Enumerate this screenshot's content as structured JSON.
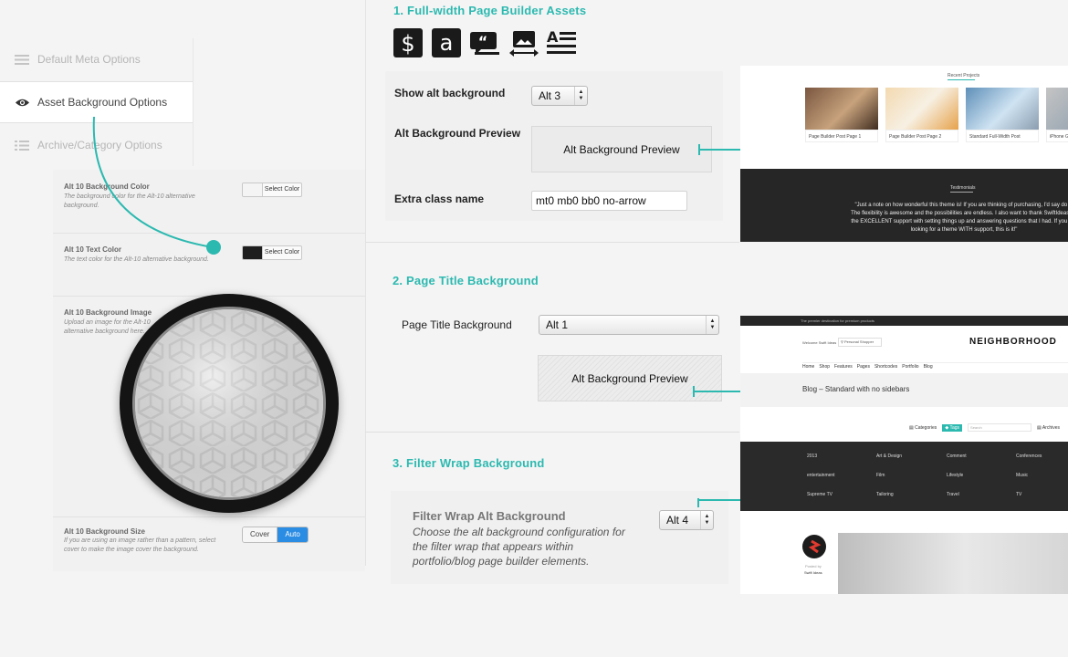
{
  "meta_tabs": [
    {
      "label": "Default Meta Options",
      "icon": "list-icon"
    },
    {
      "label": "Asset Background Options",
      "icon": "eye-icon"
    },
    {
      "label": "Archive/Category Options",
      "icon": "list-icon"
    }
  ],
  "options": {
    "bg_color": {
      "title": "Alt 10 Background Color",
      "desc": "The background color for the Alt-10 alternative background.",
      "button": "Select Color",
      "swatch": "#f4f4f4"
    },
    "text_color": {
      "title": "Alt 10 Text Color",
      "desc": "The text color for the Alt-10 alternative background.",
      "button": "Select Color",
      "swatch": "#1e1e1e"
    },
    "bg_image": {
      "title": "Alt 10 Background Image",
      "desc": "Upload an image for the Alt-10 alternative background here."
    },
    "bg_size": {
      "title": "Alt 10 Background Size",
      "desc": "If you are using an image rather than a pattern, select cover to make the image cover the background.",
      "opt_cover": "Cover",
      "opt_auto": "Auto",
      "selected": "Auto"
    }
  },
  "section1": {
    "heading": "1. Full-width Page Builder Assets",
    "icons": [
      "dollar-icon",
      "amazon-a-icon",
      "quote-icon",
      "image-slider-icon",
      "text-align-icon"
    ],
    "show_alt_label": "Show alt background",
    "show_alt_value": "Alt 3",
    "preview_label": "Alt Background Preview",
    "preview_text": "Alt Background Preview",
    "extra_label": "Extra class name",
    "extra_value": "mt0 mb0 bb0 no-arrow"
  },
  "section2": {
    "heading": "2. Page Title Background",
    "label": "Page Title Background",
    "value": "Alt 1",
    "preview_text": "Alt Background Preview"
  },
  "section3": {
    "heading": "3. Filter Wrap Background",
    "title": "Filter Wrap Alt Background",
    "desc": "Choose the alt background configuration for the filter wrap that appears within portfolio/blog page builder elements.",
    "value": "Alt 4"
  },
  "shot1": {
    "recent_title": "Recent Projects",
    "thumbs": [
      "Page Builder Post Page 1",
      "Page Builder Post Page 2",
      "Standard Full-Width Post",
      "iPhone Ga"
    ],
    "testimonials_title": "Testimonials",
    "quote": "\"Just a note on how wonderful this theme is! If you are thinking of purchasing, I'd say do it! The flexibility is awesome and the possibilities are endless. I also want to thank SwiftIdeas for the EXCELLENT support with setting things up and answering questions that I had. If you are looking for a theme WITH support, this is it!\""
  },
  "shot2": {
    "topbar": "The premier destination for premium products",
    "welcome": "Welcome Swift Ideas",
    "shopper": "Personal Shopper",
    "logo": "NEIGHBORHOOD",
    "nav": [
      "Home",
      "Shop",
      "Features",
      "Pages",
      "Shortcodes",
      "Portfolio",
      "Blog"
    ],
    "page_title": "Blog – Standard with no sidebars"
  },
  "shot3": {
    "tabs": [
      "Categories",
      "Tags",
      "Archives"
    ],
    "search_placeholder": "Search",
    "tags": [
      [
        "2013",
        "Art & Design",
        "Comment",
        "Conferences"
      ],
      [
        "entertainment",
        "Film",
        "Lifestyle",
        "Music"
      ],
      [
        "Supreme TV",
        "Tailoring",
        "Travel",
        "TV"
      ]
    ],
    "posted_by": "Posted by",
    "author": "Swift Ideas"
  },
  "colors": {
    "accent": "#2cb9b0",
    "button_blue": "#2a8ce3",
    "dark": "#262626"
  }
}
